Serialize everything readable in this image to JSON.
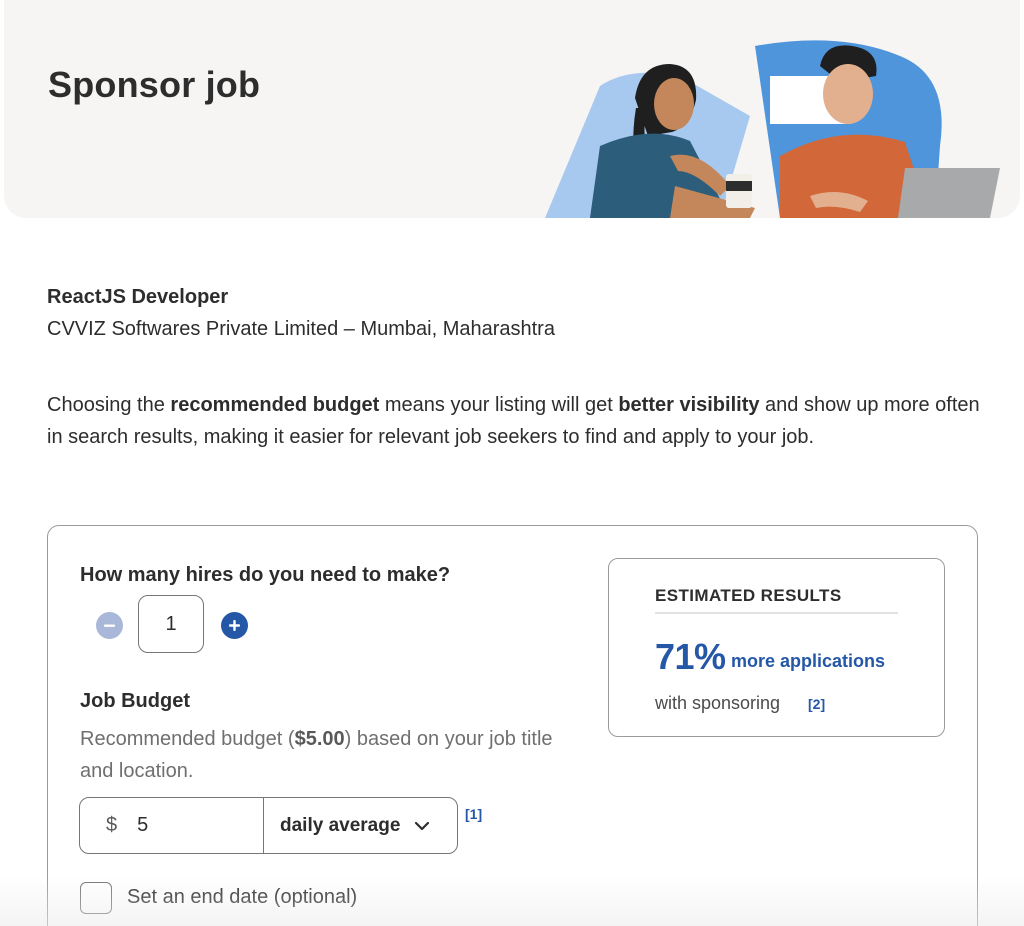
{
  "header": {
    "title": "Sponsor job"
  },
  "job": {
    "title": "ReactJS Developer",
    "company_location": "CVVIZ Softwares Private Limited – Mumbai, Maharashtra"
  },
  "intro": {
    "part1": "Choosing the ",
    "bold1": "recommended budget",
    "part2": " means your listing will get ",
    "bold2": "better visibility",
    "part3": " and show up more often in search results, making it easier for relevant job seekers to find and apply to your job."
  },
  "hires": {
    "label": "How many hires do you need to make?",
    "value": "1"
  },
  "budget": {
    "label": "Job Budget",
    "hint_prefix": "Recommended budget (",
    "hint_amount": "$5.00",
    "hint_suffix": ") based on your job title and location.",
    "currency": "$",
    "amount": "5",
    "frequency": "daily average",
    "footnote": "[1]"
  },
  "end_date": {
    "label": "Set an end date (optional)",
    "checked": false
  },
  "estimate": {
    "title": "ESTIMATED RESULTS",
    "percent": "71%",
    "more_label": "more applications",
    "with_label": "with sponsoring",
    "footnote": "[2]"
  },
  "colors": {
    "brand_blue": "#2557a7",
    "hero_bg": "#f7f5f3"
  }
}
